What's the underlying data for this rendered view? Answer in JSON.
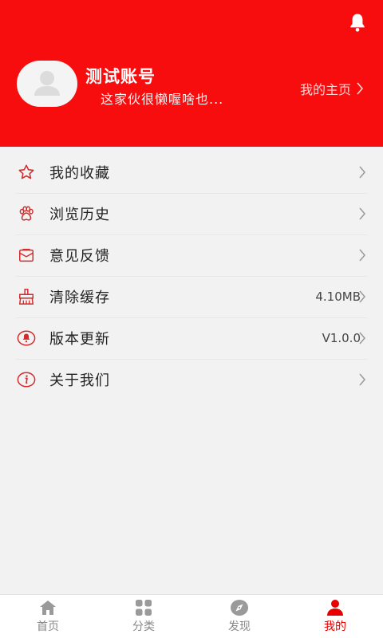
{
  "profile": {
    "username": "测试账号",
    "bio": "这家伙很懒喔啥也...",
    "homepage_label": "我的主页"
  },
  "menu": {
    "items": [
      {
        "label": "我的收藏",
        "icon": "star-icon",
        "value": ""
      },
      {
        "label": "浏览历史",
        "icon": "paw-icon",
        "value": ""
      },
      {
        "label": "意见反馈",
        "icon": "mail-icon",
        "value": ""
      },
      {
        "label": "清除缓存",
        "icon": "broom-icon",
        "value": "4.10MB"
      },
      {
        "label": "版本更新",
        "icon": "bell-circle-icon",
        "value": "V1.0.0"
      },
      {
        "label": "关于我们",
        "icon": "info-icon",
        "value": ""
      }
    ]
  },
  "tabbar": {
    "tabs": [
      {
        "label": "首页",
        "icon": "home-icon",
        "active": false
      },
      {
        "label": "分类",
        "icon": "grid-icon",
        "active": false
      },
      {
        "label": "发现",
        "icon": "compass-icon",
        "active": false
      },
      {
        "label": "我的",
        "icon": "person-icon",
        "active": true
      }
    ]
  },
  "colors": {
    "header_bg": "#f70d0d",
    "accent": "#e60000",
    "icon_red": "#d42a2a",
    "page_bg": "#f2f2f2"
  }
}
